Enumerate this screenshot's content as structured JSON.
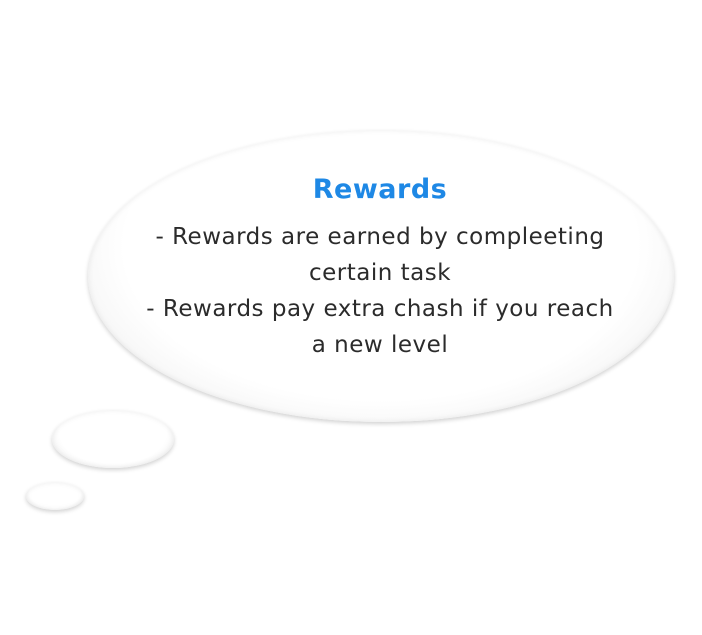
{
  "bubble": {
    "title": "Rewards",
    "lines": [
      "- Rewards are earned by compleeting",
      "certain task",
      "- Rewards pay extra chash if you reach",
      "a new level"
    ]
  },
  "colors": {
    "title": "#1e88e5",
    "text": "#2b2b2b",
    "bubble_fill": "#ffffff"
  }
}
